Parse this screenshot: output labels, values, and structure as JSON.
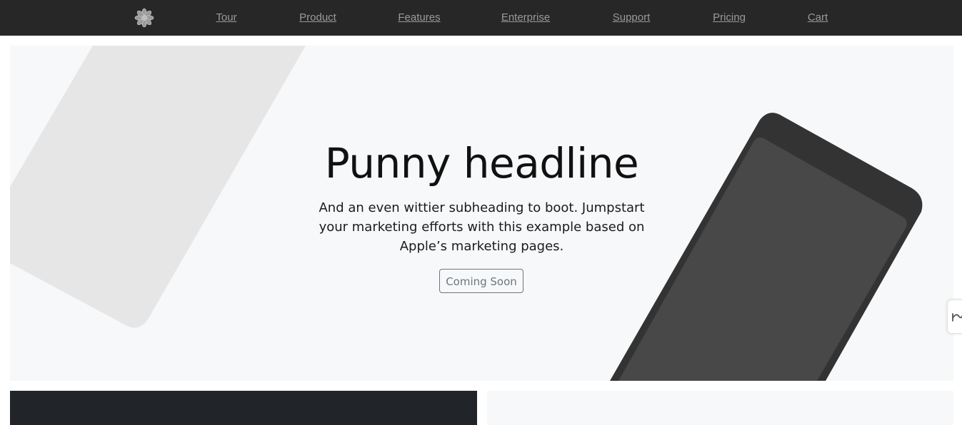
{
  "nav": {
    "logo_icon": "flower-logo-icon",
    "links": [
      {
        "label": "Tour"
      },
      {
        "label": "Product"
      },
      {
        "label": "Features"
      },
      {
        "label": "Enterprise"
      },
      {
        "label": "Support"
      },
      {
        "label": "Pricing"
      },
      {
        "label": "Cart"
      }
    ]
  },
  "hero": {
    "title": "Punny headline",
    "subtitle": "And an even wittier subheading to boot. Jumpstart your marketing efforts with this example based on Apple’s marketing pages.",
    "button_label": "Coming Soon",
    "device_icon": "phone-device-illustration"
  },
  "side_tab": {
    "icon": "pen-squiggle-icon"
  },
  "colors": {
    "nav_background": "#272727",
    "nav_link": "#9a9a9a",
    "hero_background": "#f7f8f9",
    "dark_panel": "#212529",
    "light_panel": "#f7f8f9",
    "device_frame": "#333333",
    "device_screen": "#484848",
    "left_shape": "#e6e6e6"
  }
}
